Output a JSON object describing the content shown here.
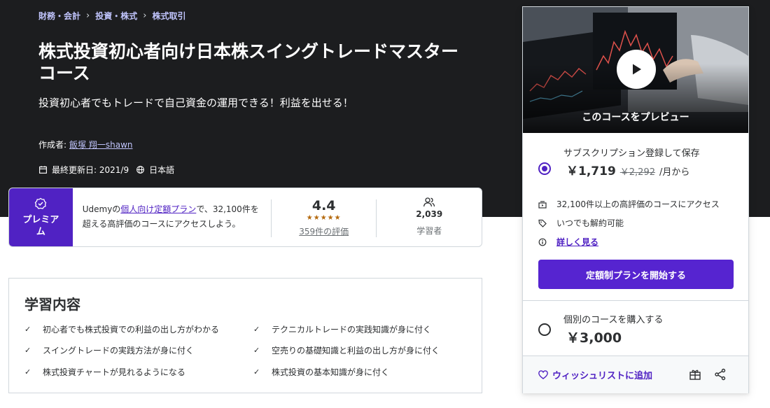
{
  "breadcrumb": [
    "財務・会計",
    "投資・株式",
    "株式取引"
  ],
  "course": {
    "title": "株式投資初心者向け日本株スイングトレードマスターコース",
    "subtitle": "投資初心者でもトレードで自己資金の運用できる！利益を出せる！",
    "author_label": "作成者:",
    "author_name": "飯塚 翔一shawn",
    "last_updated": "最終更新日: 2021/9",
    "language": "日本語"
  },
  "premium": {
    "badge": "プレミアム",
    "text_pre": "Udemyの",
    "text_link": "個人向け定額プラン",
    "text_post": "で、32,100件を超える高評価のコースにアクセスしよう。",
    "rating": "4.4",
    "stars": "★★★★★",
    "rating_count": "359件の評価",
    "learners": "2,039",
    "learners_label": "学習者"
  },
  "learn": {
    "title": "学習内容",
    "items": [
      "初心者でも株式投資での利益の出し方がわかる",
      "テクニカルトレードの実践知識が身に付く",
      "スイングトレードの実践方法が身に付く",
      "空売りの基礎知識と利益の出し方が身に付く",
      "株式投資チャートが見れるようになる",
      "株式投資の基本知識が身に付く"
    ]
  },
  "sidebar": {
    "preview_label": "このコースをプレビュー",
    "subscription_label": "サブスクリプション登録して保存",
    "subscription_price": "￥1,719",
    "subscription_original": "￥2,292",
    "subscription_period": "/月から",
    "features": [
      "32,100件以上の高評価のコースにアクセス",
      "いつでも解約可能",
      "詳しく見る"
    ],
    "cta": "定額制プランを開始する",
    "buy_label": "個別のコースを購入する",
    "buy_price": "￥3,000",
    "wishlist": "ウィッシュリストに追加"
  },
  "colors": {
    "hero_bg": "#1c1d1f",
    "accent": "#5624d0",
    "link": "#c0c4fc",
    "rating_star": "#b4690e"
  }
}
